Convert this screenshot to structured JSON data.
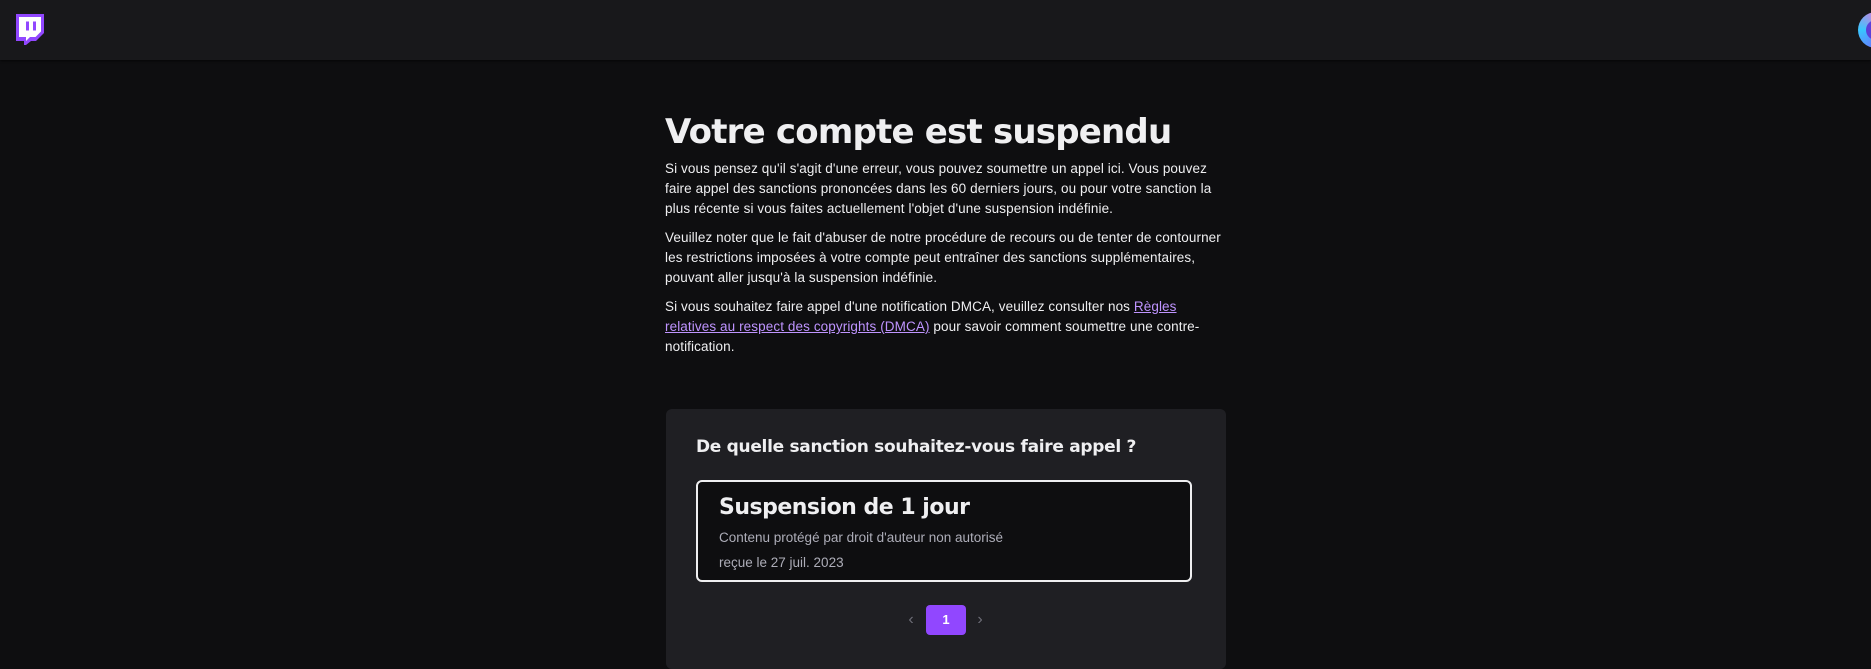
{
  "header": {
    "logo_icon": "twitch-logo-icon",
    "avatar_icon": "user-avatar-icon",
    "brand_color": "#9147ff"
  },
  "page": {
    "title": "Votre compte est suspendu",
    "para1": "Si vous pensez qu'il s'agit d'une erreur, vous pouvez soumettre un appel ici. Vous pouvez faire appel des sanctions prononcées dans les 60 derniers jours, ou pour votre sanction la plus récente si vous faites actuellement l'objet d'une suspension indéfinie.",
    "para2": "Veuillez noter que le fait d'abuser de notre procédure de recours ou de tenter de contourner les restrictions imposées à votre compte peut entraîner des sanctions supplémentaires, pouvant aller jusqu'à la suspension indéfinie.",
    "para3_before": "Si vous souhaitez faire appel d'une notification DMCA, veuillez consulter nos ",
    "para3_link": "Règles relatives au respect des copyrights (DMCA)",
    "para3_after": " pour savoir comment soumettre une contre-notification."
  },
  "appeal": {
    "question": "De quelle sanction souhaitez-vous faire appel ?",
    "options": [
      {
        "title": "Suspension de 1 jour",
        "reason": "Contenu protégé par droit d'auteur non autorisé",
        "date": "reçue le 27 juil. 2023",
        "selected": true
      }
    ],
    "pagination": {
      "prev_icon": "chevron-left-icon",
      "next_icon": "chevron-right-icon",
      "current_page": "1"
    }
  }
}
